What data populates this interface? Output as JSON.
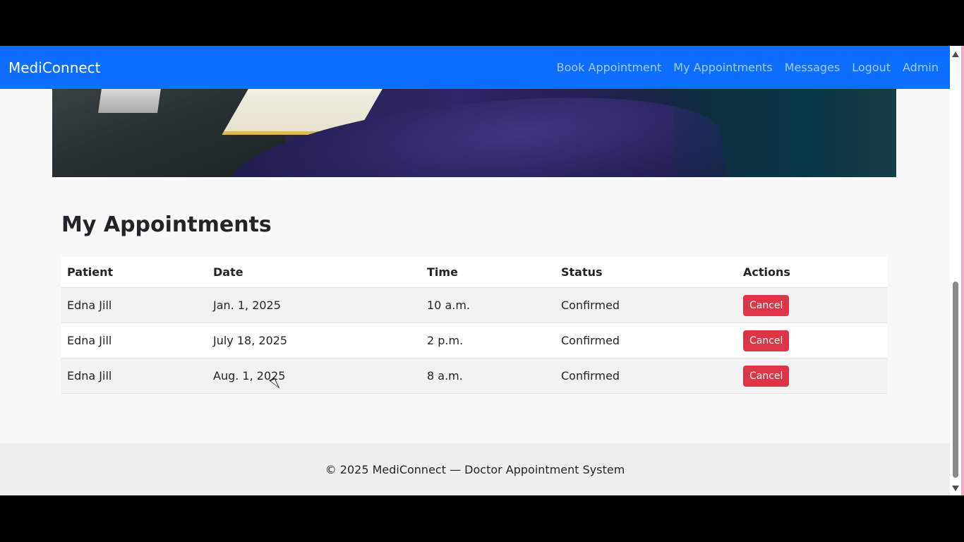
{
  "navbar": {
    "brand": "MediConnect",
    "links": [
      {
        "label": "Book Appointment"
      },
      {
        "label": "My Appointments"
      },
      {
        "label": "Messages"
      },
      {
        "label": "Logout"
      },
      {
        "label": "Admin"
      }
    ]
  },
  "page": {
    "title": "My Appointments"
  },
  "table": {
    "headers": {
      "patient": "Patient",
      "date": "Date",
      "time": "Time",
      "status": "Status",
      "actions": "Actions"
    },
    "rows": [
      {
        "patient": "Edna Jill",
        "date": "Jan. 1, 2025",
        "time": "10 a.m.",
        "status": "Confirmed",
        "action": "Cancel"
      },
      {
        "patient": "Edna Jill",
        "date": "July 18, 2025",
        "time": "2 p.m.",
        "status": "Confirmed",
        "action": "Cancel"
      },
      {
        "patient": "Edna Jill",
        "date": "Aug. 1, 2025",
        "time": "8 a.m.",
        "status": "Confirmed",
        "action": "Cancel"
      }
    ]
  },
  "footer": {
    "text": "© 2025 MediConnect — Doctor Appointment System"
  },
  "colors": {
    "navbar": "#0d6efd",
    "danger": "#dc3545",
    "footer_bg": "#efefef",
    "page_bg": "#f8f8f8"
  },
  "icons": {
    "scroll_up": "scroll-up-arrow-icon",
    "scroll_down": "scroll-down-arrow-icon",
    "cursor": "mouse-pointer-icon"
  }
}
